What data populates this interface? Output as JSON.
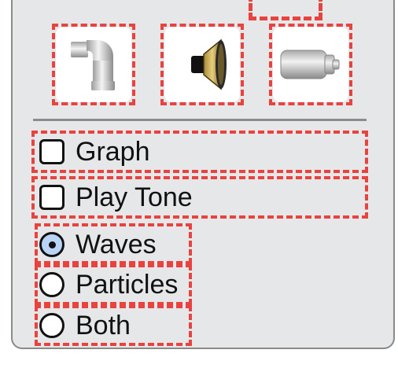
{
  "tools": [
    {
      "name": "pipe",
      "icon": "pipe-elbow-icon"
    },
    {
      "name": "speaker",
      "icon": "speaker-icon"
    },
    {
      "name": "light",
      "icon": "light-bulb-tube-icon"
    }
  ],
  "options": {
    "graph": {
      "label": "Graph",
      "checked": false
    },
    "play_tone": {
      "label": "Play Tone",
      "checked": false
    }
  },
  "view_mode": {
    "selected": "Waves",
    "items": [
      {
        "label": "Waves"
      },
      {
        "label": "Particles"
      },
      {
        "label": "Both"
      }
    ]
  },
  "colors": {
    "panel_bg": "#e6e7e8",
    "highlight_red": "#e8433f",
    "highlight_blue": "#3b3bff",
    "radio_selected_bg": "#b9d4f7"
  }
}
